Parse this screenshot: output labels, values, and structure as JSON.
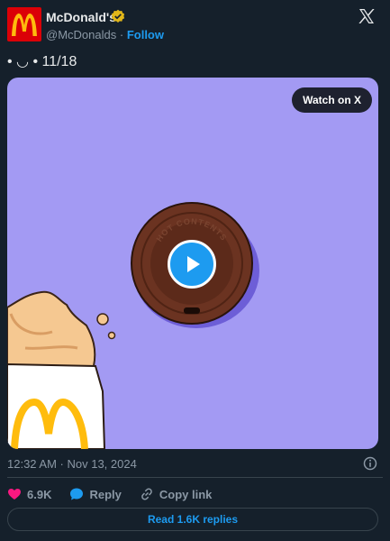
{
  "header": {
    "author_name": "McDonald's",
    "handle": "@McDonalds",
    "separator": "·",
    "follow_label": "Follow"
  },
  "tweet": {
    "text": "• ◡ • 11/18"
  },
  "media": {
    "watch_label": "Watch on X",
    "lid_text": "HOT CONTENTS"
  },
  "meta": {
    "timestamp": "12:32 AM · Nov 13, 2024"
  },
  "actions": {
    "likes": "6.9K",
    "reply_label": "Reply",
    "copy_link_label": "Copy link",
    "read_replies_label": "Read 1.6K replies"
  },
  "colors": {
    "background": "#15202b",
    "accent": "#1d9bf0",
    "like": "#f91880",
    "media_background": "#a39af3",
    "brand_red": "#db0007",
    "brand_yellow": "#ffbc0d"
  },
  "icons": [
    "mcdonalds-logo-icon",
    "verified-badge-icon",
    "x-logo-icon",
    "play-icon",
    "info-icon",
    "heart-icon",
    "reply-icon",
    "link-icon"
  ]
}
